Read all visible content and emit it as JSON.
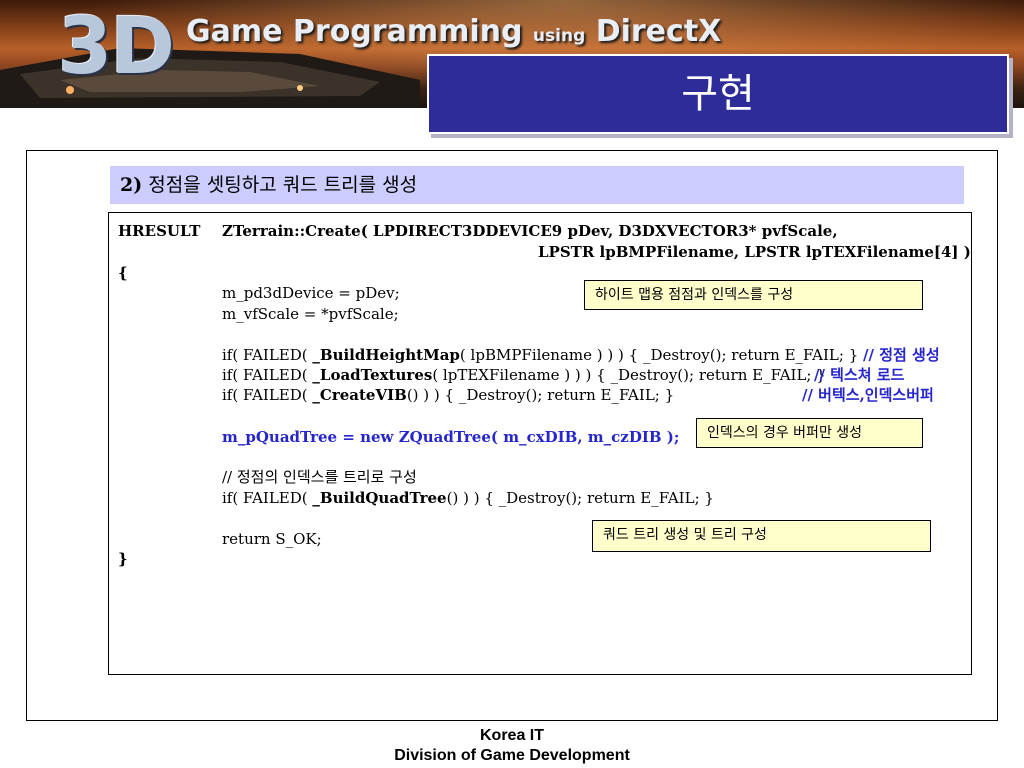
{
  "banner": {
    "logo": "3D",
    "title_main": "Game Programming",
    "title_using": "using",
    "title_end": "DirectX"
  },
  "slide_title": "구현",
  "section": {
    "number": "2)",
    "title": "정점을 셋팅하고 쿼드 트리를 생성"
  },
  "code": {
    "hresult": "HRESULT",
    "sig1": "ZTerrain::Create( LPDIRECT3DDEVICE9 pDev, D3DXVECTOR3* pvfScale,",
    "sig2": "LPSTR lpBMPFilename, LPSTR lpTEXFilename[4] )",
    "open_brace": "{",
    "l1": "m_pd3dDevice = pDev;",
    "l2": "m_vfScale = *pvfScale;",
    "l3_pre": "if( FAILED( ",
    "l3_fn": "_BuildHeightMap",
    "l3_post": "( lpBMPFilename ) ) ) { _Destroy(); return E_FAIL; }",
    "l3_comment": "// 정점 생성",
    "l4_pre": "if( FAILED( ",
    "l4_fn": "_LoadTextures",
    "l4_post": "( lpTEXFilename ) ) ) { _Destroy(); return E_FAIL; }",
    "l4_comment": "// 텍스쳐 로드",
    "l5_pre": "if( FAILED( ",
    "l5_fn": "_CreateVIB",
    "l5_post": "() ) ) { _Destroy(); return E_FAIL; }",
    "l5_comment": "// 버텍스,인덱스버퍼",
    "l6": "m_pQuadTree = new ZQuadTree( m_cxDIB, m_czDIB );",
    "l7": "// 정점의 인덱스를 트리로 구성",
    "l8_pre": "if( FAILED( ",
    "l8_fn": "_BuildQuadTree",
    "l8_post": "() ) ) { _Destroy(); return E_FAIL; }",
    "l9": "return S_OK;",
    "close_brace": "}"
  },
  "notes": {
    "n1": "하이트 맵용 점점과 인덱스를 구성",
    "n2": "인덱스의 경우 버퍼만 생성",
    "n3": "쿼드 트리 생성 및 트리 구성"
  },
  "footer": {
    "line1": "Korea IT",
    "line2": "Division of Game Development"
  },
  "colors": {
    "title_box": "#2d2c99",
    "heading_bg": "#ccccff",
    "note_bg": "#ffffcc",
    "comment_blue": "#2626cc"
  }
}
